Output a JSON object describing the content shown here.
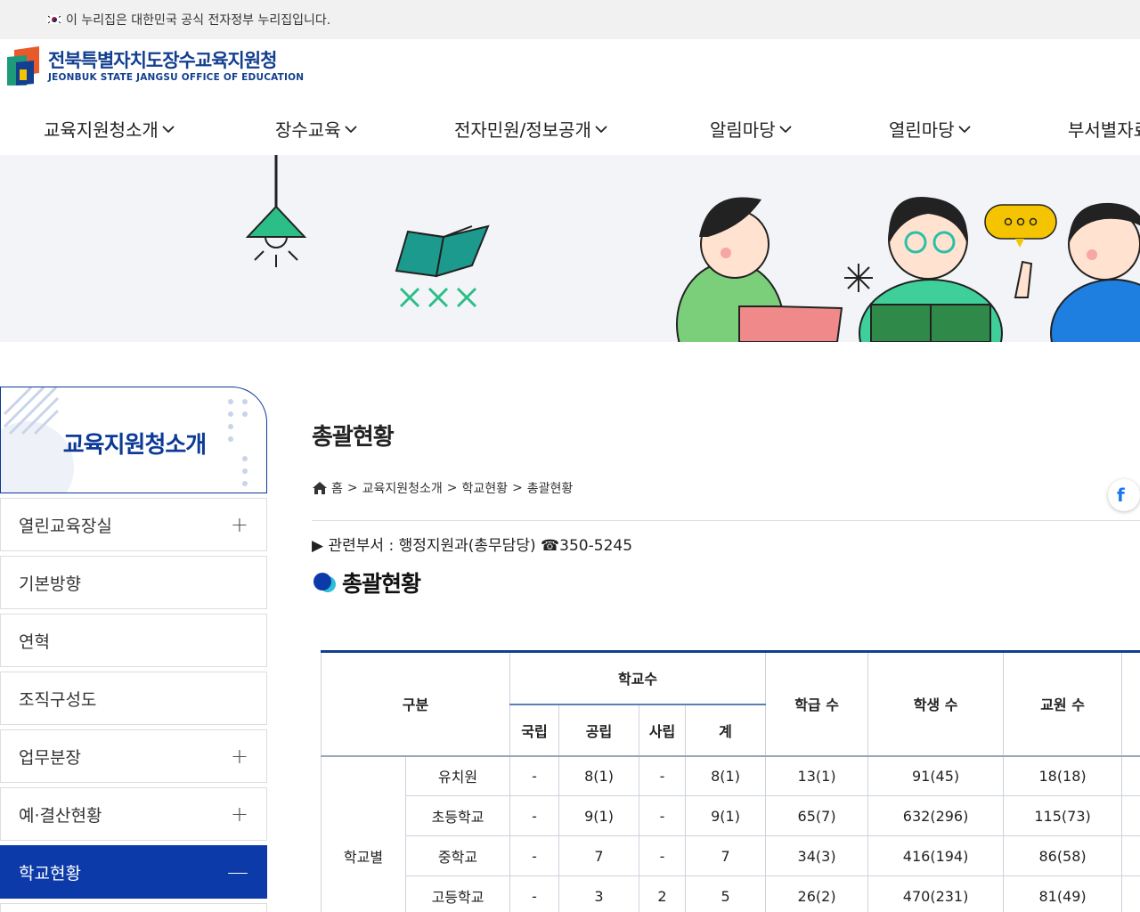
{
  "gov_notice": "이 누리집은 대한민국 공식 전자정부 누리집입니다.",
  "logo": {
    "ko": "전북특별자치도장수교육지원청",
    "en": "JEONBUK STATE JANGSU OFFICE OF EDUCATION"
  },
  "gnb": [
    {
      "label": "교육지원청소개"
    },
    {
      "label": "장수교육"
    },
    {
      "label": "전자민원/정보공개"
    },
    {
      "label": "알림마당"
    },
    {
      "label": "열린마당"
    },
    {
      "label": "부서별자료"
    }
  ],
  "lnb": {
    "title": "교육지원청소개",
    "items": [
      {
        "label": "열린교육장실",
        "expand": "+"
      },
      {
        "label": "기본방향",
        "expand": ""
      },
      {
        "label": "연혁",
        "expand": ""
      },
      {
        "label": "조직구성도",
        "expand": ""
      },
      {
        "label": "업무분장",
        "expand": "+"
      },
      {
        "label": "예·결산현황",
        "expand": "+"
      },
      {
        "label": "학교현황",
        "expand": "—"
      }
    ]
  },
  "page": {
    "title": "총괄현황",
    "breadcrumb": [
      "홈",
      "교육지원청소개",
      "학교현황",
      "총괄현황"
    ],
    "separator": ">",
    "dept": "▶ 관련부서 : 행정지원과(총무담당) ☎350-5245",
    "section_title": "총괄현황",
    "facebook": "f"
  },
  "table": {
    "headers": {
      "category": "구분",
      "schools": "학교수",
      "national": "국립",
      "public": "공립",
      "private": "사립",
      "total": "계",
      "classes": "학급 수",
      "students": "학생 수",
      "teachers": "교원 수"
    },
    "group_label": "학교별",
    "rows": [
      {
        "type": "유치원",
        "national": "-",
        "public": "8(1)",
        "private": "-",
        "total": "8(1)",
        "classes": "13(1)",
        "students": "91(45)",
        "teachers": "18(18)"
      },
      {
        "type": "초등학교",
        "national": "-",
        "public": "9(1)",
        "private": "-",
        "total": "9(1)",
        "classes": "65(7)",
        "students": "632(296)",
        "teachers": "115(73)"
      },
      {
        "type": "중학교",
        "national": "-",
        "public": "7",
        "private": "-",
        "total": "7",
        "classes": "34(3)",
        "students": "416(194)",
        "teachers": "86(58)"
      },
      {
        "type": "고등학교",
        "national": "-",
        "public": "3",
        "private": "2",
        "total": "5",
        "classes": "26(2)",
        "students": "470(231)",
        "teachers": "81(49)"
      }
    ]
  }
}
